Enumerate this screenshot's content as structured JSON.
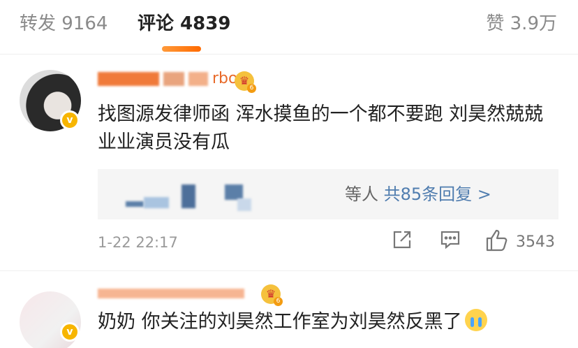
{
  "tabs": {
    "repost_label": "转发 9164",
    "comments_label": "评论 4839",
    "likes_label": "赞 3.9万"
  },
  "comments": [
    {
      "username_visible": "rbo",
      "content": "找图源发律师函  浑水摸鱼的一个都不要跑 刘昊然兢兢业业演员没有瓜",
      "replies_prefix": "等人",
      "replies_link": "共85条回复 >",
      "timestamp": "1-22 22:17",
      "like_count": "3543",
      "crown_level": "6"
    },
    {
      "content": "奶奶 你关注的刘昊然工作室为刘昊然反黑了",
      "crown_level": "6"
    }
  ],
  "icons": {
    "share": "share-icon",
    "comment": "comment-icon",
    "like": "thumbs-up-icon",
    "verified": "verified-badge-icon",
    "crown": "crown-icon",
    "emoji": "crying-emoji-icon"
  },
  "colors": {
    "accent": "#ff8200",
    "link": "#507daf",
    "verified": "#f7b500"
  }
}
